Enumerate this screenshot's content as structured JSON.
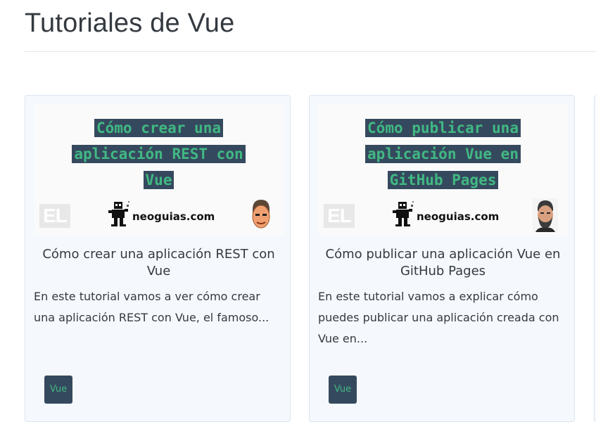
{
  "page": {
    "title": "Tutoriales de Vue"
  },
  "cards": [
    {
      "thumb_lines": [
        "Cómo crear una",
        "aplicación REST con",
        "Vue"
      ],
      "thumb_el": "EL",
      "thumb_brand": "neoguias.com",
      "title": "Cómo crear una aplicación REST con Vue",
      "excerpt": "En este tutorial vamos a ver cómo crear una aplicación REST con Vue, el famoso...",
      "tag": "Vue"
    },
    {
      "thumb_lines": [
        "Cómo publicar una",
        "aplicación Vue en",
        "GitHub Pages"
      ],
      "thumb_el": "EL",
      "thumb_brand": "neoguias.com",
      "title": "Cómo publicar una aplicación Vue en GitHub Pages",
      "excerpt": "En este tutorial vamos a explicar cómo puedes publicar una aplicación creada con Vue en...",
      "tag": "Vue"
    }
  ],
  "colors": {
    "vue_dark": "#35495e",
    "vue_green": "#41b883",
    "card_bg": "#f5f9fd"
  },
  "icons": {
    "brand_logo": "robot-mascot-icon",
    "author": "author-avatar-icon"
  }
}
